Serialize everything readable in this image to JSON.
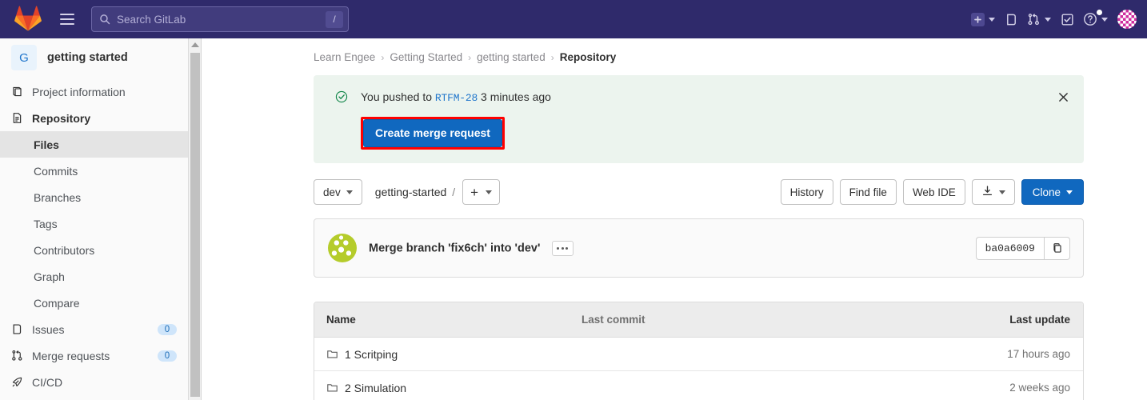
{
  "topnav": {
    "logo_icon": "gitlab-logo",
    "menu_icon": "hamburger-menu-icon",
    "search": {
      "placeholder": "Search GitLab",
      "value": "",
      "shortcut": "/",
      "icon": "search-icon"
    },
    "actions": [
      {
        "name": "create-new-menu",
        "icon": "plus-square-icon",
        "has_caret": true
      },
      {
        "name": "issues-nav",
        "icon": "issues-icon",
        "has_caret": false
      },
      {
        "name": "merge-requests-nav",
        "icon": "merge-request-icon",
        "has_caret": true
      },
      {
        "name": "todos-nav",
        "icon": "todo-check-icon",
        "has_caret": false
      },
      {
        "name": "help-menu",
        "icon": "help-question-icon",
        "has_caret": true,
        "has_dot": true
      }
    ],
    "avatar_icon": "user-avatar"
  },
  "sidebar": {
    "project": {
      "initial": "G",
      "name": "getting started"
    },
    "items": [
      {
        "label": "Project information",
        "icon": "project-info-icon",
        "bold": false,
        "badge": ""
      },
      {
        "label": "Repository",
        "icon": "repository-doc-icon",
        "bold": true,
        "badge": ""
      }
    ],
    "sub_items": [
      {
        "label": "Files",
        "selected": true
      },
      {
        "label": "Commits",
        "selected": false
      },
      {
        "label": "Branches",
        "selected": false
      },
      {
        "label": "Tags",
        "selected": false
      },
      {
        "label": "Contributors",
        "selected": false
      },
      {
        "label": "Graph",
        "selected": false
      },
      {
        "label": "Compare",
        "selected": false
      }
    ],
    "items_after": [
      {
        "label": "Issues",
        "icon": "issues-icon",
        "badge": "0"
      },
      {
        "label": "Merge requests",
        "icon": "merge-request-icon",
        "badge": "0"
      },
      {
        "label": "CI/CD",
        "icon": "rocket-icon",
        "badge": ""
      }
    ]
  },
  "breadcrumb": {
    "items": [
      {
        "label": "Learn Engee",
        "current": false
      },
      {
        "label": "Getting Started",
        "current": false
      },
      {
        "label": "getting started",
        "current": false
      },
      {
        "label": "Repository",
        "current": true
      }
    ],
    "separator": "›"
  },
  "alert": {
    "icon": "success-check-icon",
    "text_before": "You pushed to",
    "branch": "RTFM-28",
    "text_after": "3 minutes ago",
    "button_label": "Create merge request",
    "close_icon": "close-icon",
    "highlight_color": "#ff0000",
    "button_color": "#1068bf",
    "background_color": "#ecf4ee"
  },
  "toolbar": {
    "branch_label": "dev",
    "path_root": "getting-started",
    "path_separator": "/",
    "add_label": "+",
    "history_label": "History",
    "find_file_label": "Find file",
    "web_ide_label": "Web IDE",
    "download_icon": "download-icon",
    "clone_label": "Clone"
  },
  "commit": {
    "avatar_icon": "identicon-avatar",
    "title": "Merge branch 'fix6ch' into 'dev'",
    "more_icon": "ellipsis-icon",
    "sha": "ba0a6009",
    "copy_icon": "copy-icon"
  },
  "file_table": {
    "columns": [
      "Name",
      "Last commit",
      "Last update"
    ],
    "rows": [
      {
        "icon": "folder-icon",
        "name": "1 Scritping",
        "last_commit": "",
        "last_update": "17 hours ago"
      },
      {
        "icon": "folder-icon",
        "name": "2 Simulation",
        "last_commit": "",
        "last_update": "2 weeks ago"
      }
    ]
  }
}
